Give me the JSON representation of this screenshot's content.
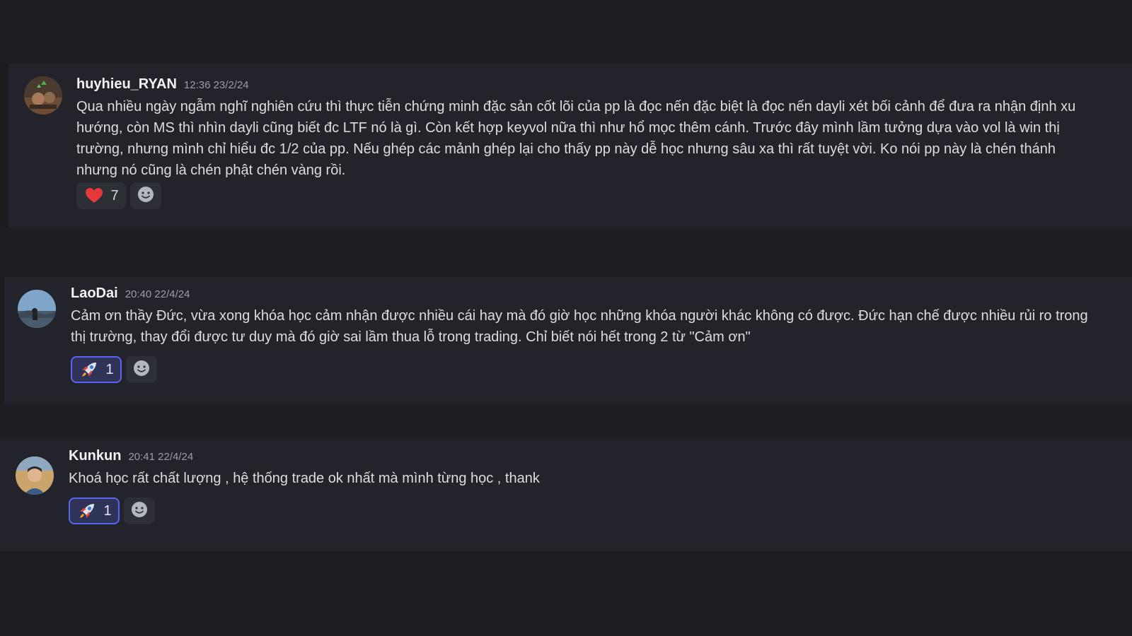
{
  "messages": [
    {
      "username": "huyhieu_RYAN",
      "timestamp": "12:36 23/2/24",
      "lines": [
        "Qua nhiều ngày ngẫm nghĩ nghiên cứu thì thực tiễn chứng minh đặc sản cốt lõi của pp là đọc nến đặc biệt là đọc nến dayli xét bối cảnh để đưa ra nhận định xu",
        "hướng, còn MS thì nhìn dayli cũng biết đc LTF nó là gì. Còn kết hợp keyvol nữa thì như hổ mọc thêm cánh. Trước đây mình lầm tưởng dựa vào vol là win thị",
        "trường, nhưng mình chỉ hiểu đc 1/2 của pp. Nếu ghép các mảnh ghép lại cho thấy pp này dễ học nhưng sâu xa thì rất tuyệt vời. Ko nói pp này là chén thánh",
        "nhưng nó cũng là chén phật chén vàng rồi."
      ],
      "reaction": {
        "icon": "heart-icon",
        "count": "7"
      }
    },
    {
      "username": "LaoDai",
      "timestamp": "20:40 22/4/24",
      "lines": [
        "Cảm ơn thầy Đức, vừa xong khóa học cảm nhận được nhiều cái hay mà đó giờ học những khóa người khác không có được. Đức hạn chế được nhiều rủi ro trong",
        "thị trường, thay đổi được tư duy mà đó giờ sai lầm thua lỗ trong trading. Chỉ biết nói hết trong 2 từ \"Cảm ơn\""
      ],
      "reaction": {
        "icon": "rocket-icon",
        "count": "1"
      }
    },
    {
      "username": "Kunkun",
      "timestamp": "20:41 22/4/24",
      "lines": [
        "Khoá học rất chất lượng , hệ thống trade ok nhất mà mình từng học , thank"
      ],
      "reaction": {
        "icon": "rocket-icon",
        "count": "1"
      }
    }
  ],
  "colors": {
    "background": "#1e1f24",
    "message_bg": "#23242b",
    "accent": "#5865f2",
    "heart": "#e5383b"
  }
}
